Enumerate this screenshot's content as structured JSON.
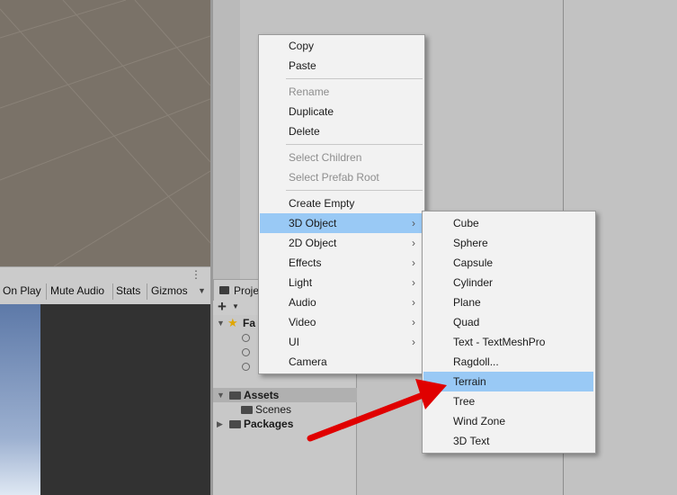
{
  "game_toolbar": {
    "buttons": [
      "On Play",
      "Mute Audio",
      "Stats",
      "Gizmos"
    ],
    "dropdown_icon": "caret-down-icon",
    "more_icon": "vertical-dots-icon"
  },
  "project": {
    "tab_label": "Proje",
    "tree": [
      {
        "label": "Fa",
        "icon": "star-icon"
      },
      {
        "label": "",
        "icon": "search-icon"
      },
      {
        "label": "",
        "icon": "search-icon"
      },
      {
        "label": "",
        "icon": "search-icon"
      },
      {
        "label": "Assets",
        "icon": "folder-icon"
      },
      {
        "label": "Scenes",
        "icon": "folder-icon"
      },
      {
        "label": "Packages",
        "icon": "folder-icon"
      }
    ]
  },
  "context_menu": {
    "items": [
      {
        "label": "Copy"
      },
      {
        "label": "Paste"
      },
      {
        "label": "Rename",
        "disabled": true
      },
      {
        "label": "Duplicate"
      },
      {
        "label": "Delete"
      },
      {
        "label": "Select Children",
        "disabled": true
      },
      {
        "label": "Select Prefab Root",
        "disabled": true
      },
      {
        "label": "Create Empty"
      },
      {
        "label": "3D Object",
        "submenu": true,
        "highlighted": true
      },
      {
        "label": "2D Object",
        "submenu": true
      },
      {
        "label": "Effects",
        "submenu": true
      },
      {
        "label": "Light",
        "submenu": true
      },
      {
        "label": "Audio",
        "submenu": true
      },
      {
        "label": "Video",
        "submenu": true
      },
      {
        "label": "UI",
        "submenu": true
      },
      {
        "label": "Camera"
      }
    ],
    "submenu_chevron": "›"
  },
  "submenu_3d": {
    "items": [
      {
        "label": "Cube"
      },
      {
        "label": "Sphere"
      },
      {
        "label": "Capsule"
      },
      {
        "label": "Cylinder"
      },
      {
        "label": "Plane"
      },
      {
        "label": "Quad"
      },
      {
        "label": "Text - TextMeshPro"
      },
      {
        "label": "Ragdoll..."
      },
      {
        "label": "Terrain",
        "highlighted": true
      },
      {
        "label": "Tree"
      },
      {
        "label": "Wind Zone"
      },
      {
        "label": "3D Text"
      }
    ]
  },
  "colors": {
    "highlight": "#99c9f5",
    "annotation_arrow": "#e00000"
  }
}
